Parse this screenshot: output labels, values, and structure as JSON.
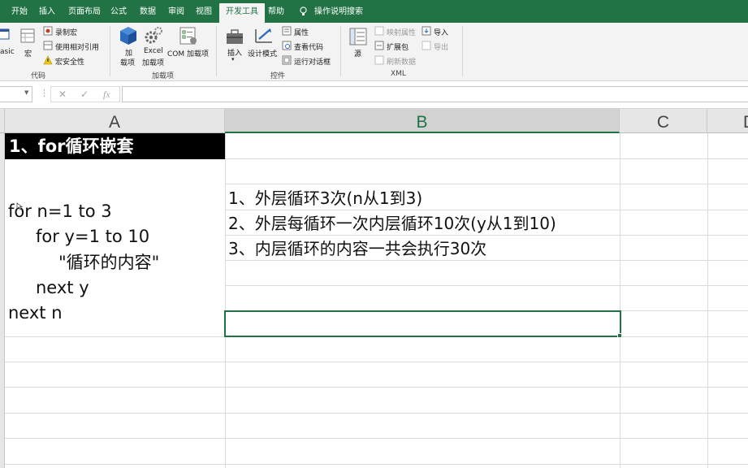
{
  "ribbon_tabs": [
    "开始",
    "插入",
    "页面布局",
    "公式",
    "数据",
    "审阅",
    "视图",
    "开发工具",
    "帮助",
    "操作说明搜索"
  ],
  "active_tab": "开发工具",
  "ribbon": {
    "code": {
      "visual_basic_partial": "asic",
      "macros": "宏",
      "record_macro": "录制宏",
      "relative_refs": "使用相对引用",
      "macro_security": "宏安全性",
      "label": "代码"
    },
    "addins": {
      "addins_line1": "加",
      "addins_line2": "载项",
      "excel_addins_line1": "Excel",
      "excel_addins_line2": "加载项",
      "com_addins": "COM 加载项",
      "label": "加载项"
    },
    "controls": {
      "insert": "插入",
      "design_mode": "设计模式",
      "properties": "属性",
      "view_code": "查看代码",
      "run_dialog": "运行对话框",
      "label": "控件"
    },
    "xml": {
      "source": "源",
      "map_properties": "映射属性",
      "expansion_packs": "扩展包",
      "refresh_data": "刷新数据",
      "import": "导入",
      "export": "导出",
      "label": "XML"
    }
  },
  "formula_bar": {
    "dots": "⋮",
    "cancel_icon": "✕",
    "enter_icon": "✓",
    "fx_label": "fx",
    "value": ""
  },
  "columns": [
    "A",
    "B",
    "C",
    "D"
  ],
  "selected_column": "B",
  "cells": {
    "a1": "1、for循环嵌套",
    "code_lines": [
      "for n=1 to 3",
      "for y=1 to 10",
      "\"循环的内容\"",
      "next y",
      "next n"
    ],
    "b_lines": [
      "1、外层循环3次(n从1到3)",
      "2、外层每循环一次内层循环10次(y从1到10)",
      "3、内层循环的内容一共会执行30次"
    ]
  },
  "colors": {
    "excel_green": "#217346",
    "ribbon_bg": "#f3f3f3",
    "header_bg": "#e6e6e6"
  }
}
